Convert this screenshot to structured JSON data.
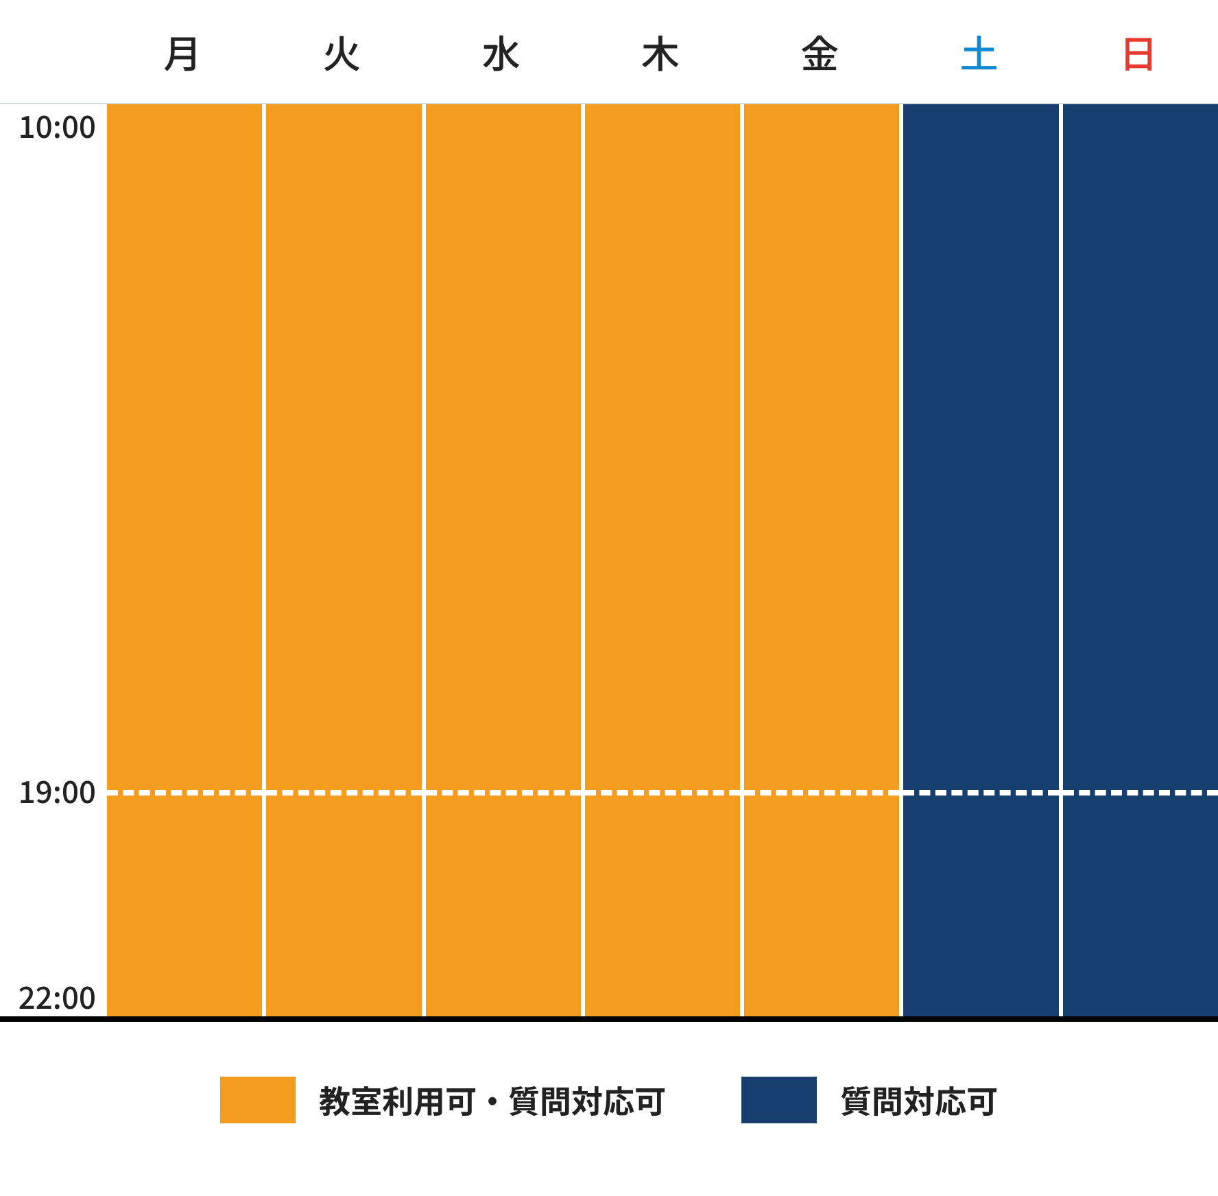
{
  "days": [
    "月",
    "火",
    "水",
    "木",
    "金",
    "土",
    "日"
  ],
  "times": {
    "start": "10:00",
    "mid": "19:00",
    "end": "22:00"
  },
  "legend": [
    {
      "label": "教室利用可・質問対応可",
      "color": "orange"
    },
    {
      "label": "質問対応可",
      "color": "navy"
    }
  ],
  "chart_data": {
    "type": "area",
    "title": "",
    "xlabel": "",
    "ylabel": "",
    "categories": [
      "月",
      "火",
      "水",
      "木",
      "金",
      "土",
      "日"
    ],
    "y_axis": {
      "start": 10,
      "mid": 19,
      "end": 22,
      "unit": "時"
    },
    "series": [
      {
        "name": "教室利用可・質問対応可",
        "color": "#F39C1F",
        "blocks": [
          {
            "day": "月",
            "from": 10,
            "to": 22
          },
          {
            "day": "火",
            "from": 10,
            "to": 22
          },
          {
            "day": "水",
            "from": 10,
            "to": 22
          },
          {
            "day": "木",
            "from": 10,
            "to": 22
          },
          {
            "day": "金",
            "from": 10,
            "to": 22
          }
        ]
      },
      {
        "name": "質問対応可",
        "color": "#163E6E",
        "blocks": [
          {
            "day": "土",
            "from": 10,
            "to": 22
          },
          {
            "day": "日",
            "from": 10,
            "to": 22
          }
        ]
      }
    ],
    "reference_lines": [
      {
        "y": 19,
        "style": "dashed"
      }
    ]
  }
}
